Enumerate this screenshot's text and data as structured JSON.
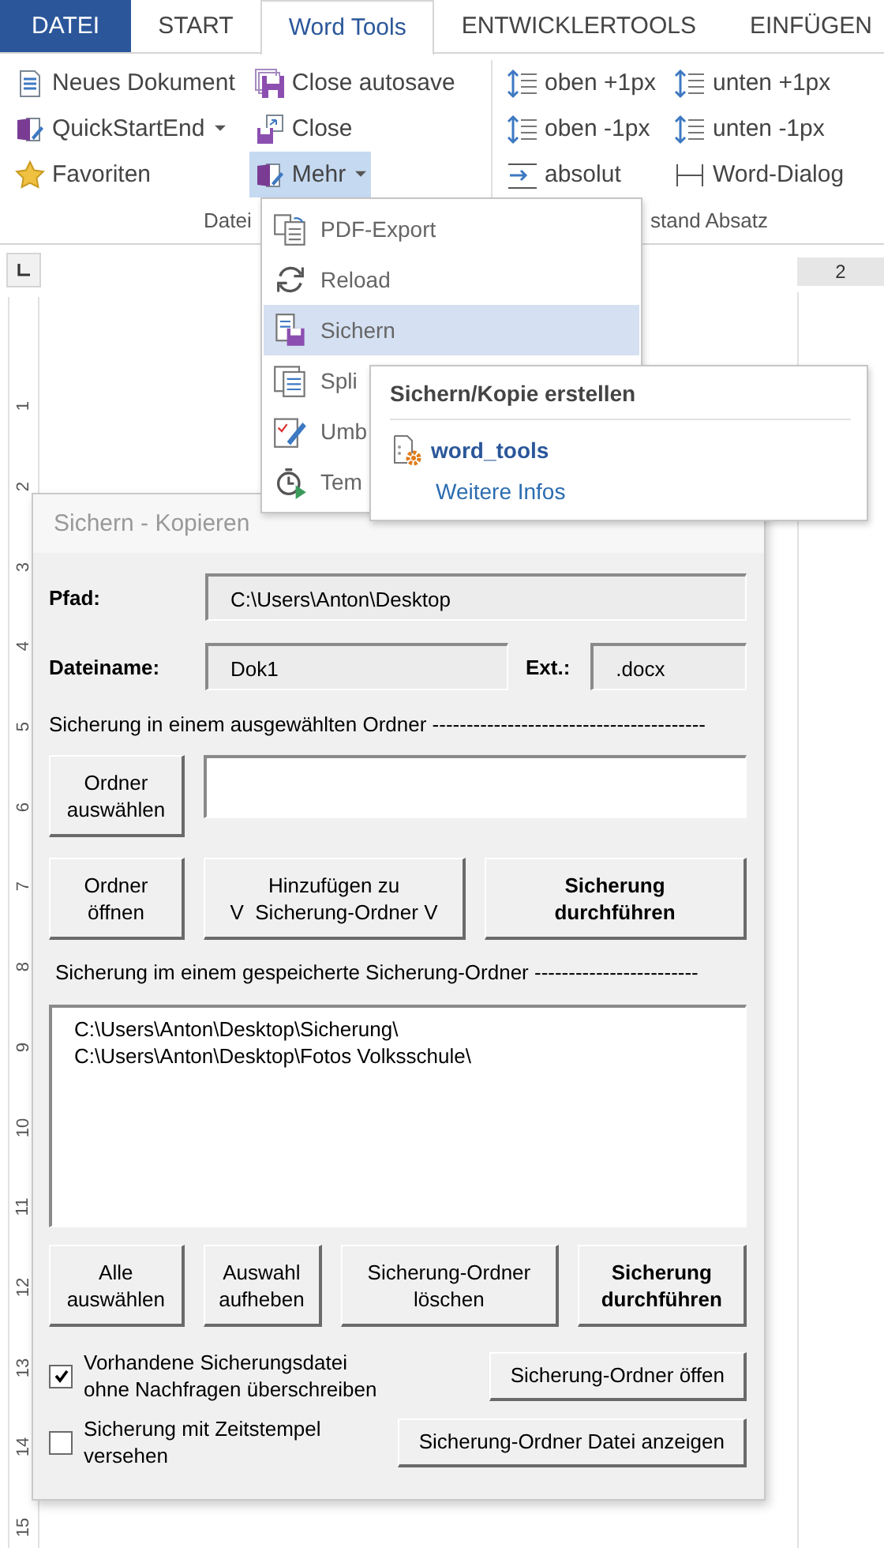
{
  "tabs": [
    {
      "label": "DATEI",
      "kind": "file",
      "selected": false
    },
    {
      "label": "START",
      "kind": "tab",
      "selected": false
    },
    {
      "label": "Word Tools",
      "kind": "tab",
      "selected": true
    },
    {
      "label": "ENTWICKLERTOOLS",
      "kind": "tab",
      "selected": false
    },
    {
      "label": "EINFÜGEN",
      "kind": "tab",
      "selected": false
    }
  ],
  "ribbon": {
    "groups": [
      {
        "label": "Datei",
        "columns": [
          [
            {
              "label": "Neues Dokument",
              "dropdown": false,
              "pressed": false
            },
            {
              "label": "QuickStartEnd",
              "dropdown": true,
              "pressed": false
            },
            {
              "label": "Favoriten",
              "dropdown": false,
              "pressed": false
            }
          ],
          [
            {
              "label": "Close autosave",
              "dropdown": false,
              "pressed": false
            },
            {
              "label": "Close",
              "dropdown": false,
              "pressed": false
            },
            {
              "label": "Mehr",
              "dropdown": true,
              "pressed": true
            }
          ]
        ]
      },
      {
        "label": "stand Absatz",
        "columns": [
          [
            {
              "label": "oben +1px",
              "dropdown": false,
              "pressed": false
            },
            {
              "label": "oben -1px",
              "dropdown": false,
              "pressed": false
            },
            {
              "label": "absolut",
              "dropdown": false,
              "pressed": false
            }
          ],
          [
            {
              "label": "unten +1px",
              "dropdown": false,
              "pressed": false
            },
            {
              "label": "unten -1px",
              "dropdown": false,
              "pressed": false
            },
            {
              "label": "Word-Dialog",
              "dropdown": false,
              "pressed": false
            }
          ]
        ]
      }
    ]
  },
  "top_ruler": [
    "2"
  ],
  "left_ruler": [
    "1",
    "2",
    "3",
    "4",
    "5",
    "6",
    "7",
    "8",
    "9",
    "10",
    "11",
    "12",
    "13",
    "14",
    "15"
  ],
  "menu": {
    "items": [
      {
        "label": "PDF-Export",
        "selected": false
      },
      {
        "label": "Reload",
        "selected": false
      },
      {
        "label": "Sichern",
        "selected": true
      },
      {
        "label": "Spli",
        "selected": false
      },
      {
        "label": "Umb",
        "selected": false
      },
      {
        "label": "Tem",
        "selected": false
      }
    ]
  },
  "tooltip": {
    "title": "Sichern/Kopie erstellen",
    "addin": "word_tools",
    "link": "Weitere Infos"
  },
  "dialog": {
    "title": "Sichern - Kopieren",
    "path": {
      "label": "Pfad:",
      "value": "C:\\Users\\Anton\\Desktop"
    },
    "filename": {
      "label": "Dateiname:",
      "value": "Dok1"
    },
    "ext": {
      "label": "Ext.:",
      "value": ".docx"
    },
    "section_1": "Sicherung in einem ausgewählten Ordner ----------------------------------------",
    "select_button": {
      "lines": [
        "Ordner",
        "auswählen"
      ]
    },
    "action_buttons": [
      {
        "lines": [
          "Ordner",
          "öffnen"
        ],
        "primary": false
      },
      {
        "lines": [
          "Hinzufügen zu",
          "V  Sicherung-Ordner V"
        ],
        "primary": false
      },
      {
        "lines": [
          "Sicherung",
          "durchführen"
        ],
        "primary": true
      }
    ],
    "section_2": "Sicherung im einem gespeicherte Sicherung-Ordner ------------------------",
    "folders": [
      "C:\\Users\\Anton\\Desktop\\Sicherung\\",
      "C:\\Users\\Anton\\Desktop\\Fotos Volksschule\\"
    ],
    "list_buttons": [
      {
        "lines": [
          "Alle",
          "auswählen"
        ],
        "primary": false
      },
      {
        "lines": [
          "Auswahl",
          "aufheben"
        ],
        "primary": false
      },
      {
        "lines": [
          "Sicherung-Ordner",
          "löschen"
        ],
        "primary": false
      },
      {
        "lines": [
          "Sicherung",
          "durchführen"
        ],
        "primary": true
      }
    ],
    "options": [
      {
        "lines": [
          "Vorhandene Sicherungsdatei",
          "ohne Nachfragen überschreiben"
        ],
        "checked": true,
        "button": "Sicherung-Ordner öffen"
      },
      {
        "lines": [
          "Sicherung mit Zeitstempel",
          "versehen"
        ],
        "checked": false,
        "button": "Sicherung-Ordner Datei anzeigen"
      }
    ]
  }
}
